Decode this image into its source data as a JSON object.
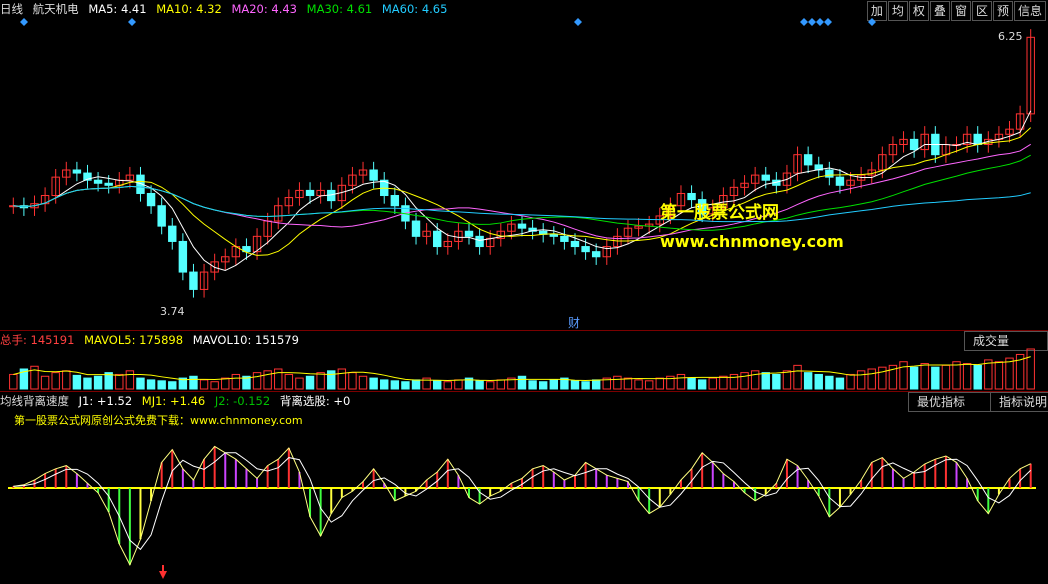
{
  "main": {
    "period": "日线",
    "stock": "航天机电",
    "ma": [
      {
        "label": "MA5: 4.41",
        "color": "#ffffff"
      },
      {
        "label": "MA10: 4.32",
        "color": "#ffff00"
      },
      {
        "label": "MA20: 4.43",
        "color": "#ff66ff"
      },
      {
        "label": "MA30: 4.61",
        "color": "#00e000"
      },
      {
        "label": "MA60: 4.65",
        "color": "#22ccff"
      }
    ],
    "high_label": "6.25",
    "low_label": "3.74",
    "event_label": "财",
    "toolbar": [
      "加",
      "均",
      "权",
      "叠",
      "窗",
      "区",
      "预",
      "信息"
    ],
    "watermark1": "第一股票公式网",
    "watermark2": "www.chnmoney.com"
  },
  "volume": {
    "total": "总手: 145191",
    "mavol5": "MAVOL5: 175898",
    "mavol10": "MAVOL10: 151579",
    "button": "成交量"
  },
  "indicator": {
    "name": "均线背离速度",
    "j1": "J1: +1.52",
    "mj1": "MJ1: +1.46",
    "j2": "J2: -0.152",
    "sel": "背离选股: +0",
    "buttons": [
      "最优指标",
      "指标说明"
    ],
    "note": "第一股票公式网原创公式免费下载：www.chnmoney.com"
  },
  "colors": {
    "up": "#ff3232",
    "down": "#54ffff",
    "bg": "#000000"
  },
  "chart_data": {
    "type": "candlestick",
    "ylim": [
      3.5,
      6.4
    ],
    "close": [
      4.6,
      4.58,
      4.62,
      4.7,
      4.88,
      4.95,
      4.92,
      4.85,
      4.82,
      4.8,
      4.85,
      4.9,
      4.72,
      4.6,
      4.4,
      4.25,
      3.95,
      3.78,
      3.95,
      4.05,
      4.1,
      4.2,
      4.15,
      4.3,
      4.45,
      4.6,
      4.68,
      4.75,
      4.7,
      4.75,
      4.65,
      4.8,
      4.9,
      4.95,
      4.85,
      4.7,
      4.6,
      4.45,
      4.3,
      4.35,
      4.2,
      4.25,
      4.35,
      4.3,
      4.2,
      4.28,
      4.35,
      4.42,
      4.38,
      4.35,
      4.32,
      4.3,
      4.25,
      4.2,
      4.15,
      4.1,
      4.2,
      4.3,
      4.38,
      4.4,
      4.42,
      4.5,
      4.6,
      4.72,
      4.66,
      4.52,
      4.58,
      4.7,
      4.78,
      4.82,
      4.9,
      4.85,
      4.8,
      4.92,
      5.1,
      5.0,
      4.95,
      4.88,
      4.8,
      4.85,
      4.9,
      4.95,
      5.1,
      5.2,
      5.25,
      5.15,
      5.3,
      5.1,
      5.2,
      5.2,
      5.3,
      5.2,
      5.25,
      5.3,
      5.35,
      5.5,
      6.25
    ],
    "volume": [
      16,
      22,
      25,
      14,
      18,
      20,
      15,
      12,
      14,
      18,
      16,
      20,
      12,
      10,
      9,
      8,
      12,
      14,
      10,
      8,
      12,
      16,
      14,
      18,
      20,
      22,
      16,
      12,
      14,
      18,
      20,
      22,
      18,
      14,
      12,
      10,
      9,
      8,
      10,
      12,
      9,
      8,
      10,
      12,
      9,
      8,
      10,
      12,
      14,
      9,
      8,
      10,
      12,
      9,
      8,
      10,
      12,
      14,
      12,
      10,
      9,
      12,
      14,
      16,
      12,
      10,
      12,
      14,
      16,
      18,
      20,
      18,
      16,
      20,
      26,
      18,
      16,
      14,
      12,
      16,
      20,
      22,
      24,
      26,
      30,
      24,
      28,
      24,
      26,
      30,
      28,
      26,
      32,
      30,
      34,
      38,
      44
    ],
    "indicator_j1": [
      0.1,
      0.2,
      0.5,
      0.9,
      1.2,
      1.4,
      0.9,
      0.3,
      -0.3,
      -1.5,
      -3.5,
      -4.8,
      -3.2,
      -0.8,
      1.6,
      2.4,
      1.2,
      0.5,
      1.8,
      2.6,
      2.2,
      1.8,
      1.2,
      0.6,
      1.4,
      1.8,
      2.5,
      1.0,
      -1.8,
      -3.0,
      -1.6,
      -0.6,
      -0.2,
      0.4,
      1.2,
      0.3,
      -0.8,
      -0.5,
      -0.2,
      0.5,
      1.0,
      1.8,
      0.8,
      -0.6,
      -1.0,
      -0.5,
      -0.2,
      0.3,
      0.6,
      1.2,
      1.4,
      1.0,
      0.5,
      0.8,
      1.6,
      1.2,
      0.8,
      0.6,
      0.4,
      -0.8,
      -1.6,
      -1.2,
      -0.4,
      0.5,
      1.2,
      2.2,
      1.6,
      0.9,
      0.4,
      -0.3,
      -0.8,
      -0.4,
      0.3,
      1.8,
      1.4,
      0.5,
      -0.5,
      -1.8,
      -1.2,
      -0.4,
      0.5,
      1.6,
      1.9,
      1.2,
      0.6,
      1.0,
      1.5,
      1.8,
      2.0,
      1.6,
      0.6,
      -0.8,
      -1.6,
      -0.4,
      0.6,
      1.2,
      1.52
    ]
  }
}
